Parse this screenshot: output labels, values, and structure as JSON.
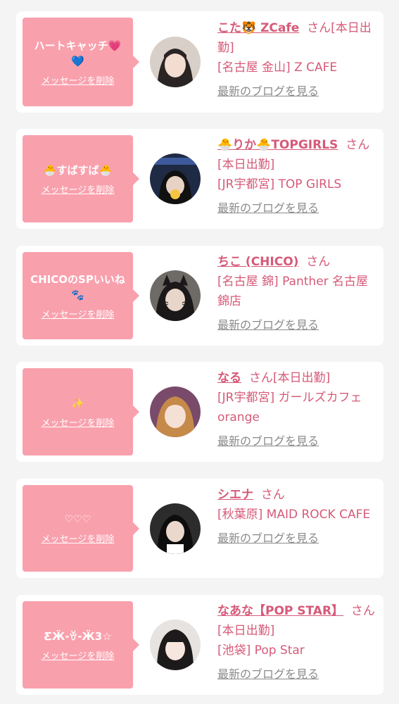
{
  "colors": {
    "accent": "#d65a78",
    "bubble": "#f9a0ad",
    "link_gray": "#8a8a8a"
  },
  "items": [
    {
      "message": "ハートキャッチ💗💙",
      "delete_label": "メッセージを削除",
      "name": "こた🐯 ZCafe",
      "san": "さん",
      "status": "[本日出勤]",
      "shop": "[名古屋 金山] Z CAFE",
      "blog_label": "最新のブログを見る"
    },
    {
      "message": "🐣すばすば🐣",
      "delete_label": "メッセージを削除",
      "name": "🐣りか🐣TOPGIRLS",
      "san": "さん",
      "status": "[本日出勤]",
      "shop": "[JR宇都宮] TOP GIRLS",
      "blog_label": "最新のブログを見る"
    },
    {
      "message": "CHICOのSPいいね🐾",
      "delete_label": "メッセージを削除",
      "name": "ちこ (CHICO)",
      "san": "さん",
      "status": "",
      "shop": "[名古屋 錦] Panther 名古屋錦店",
      "blog_label": "最新のブログを見る"
    },
    {
      "message": "✨",
      "delete_label": "メッセージを削除",
      "name": "なる",
      "san": "さん",
      "status": "[本日出勤]",
      "shop": "[JR宇都宮] ガールズカフェ orange",
      "blog_label": "最新のブログを見る"
    },
    {
      "message": "♡♡♡",
      "delete_label": "メッセージを削除",
      "name": "シエナ",
      "san": "さん",
      "status": "",
      "shop": "[秋葉原] MAID ROCK CAFE",
      "blog_label": "最新のブログを見る"
    },
    {
      "message": "ƸӜ-ꈊ-Ӝ3☆",
      "delete_label": "メッセージを削除",
      "name": "なあな【POP STAR】",
      "san": "さん",
      "status": "[本日出勤]",
      "shop": "[池袋] Pop Star",
      "blog_label": "最新のブログを見る"
    }
  ]
}
